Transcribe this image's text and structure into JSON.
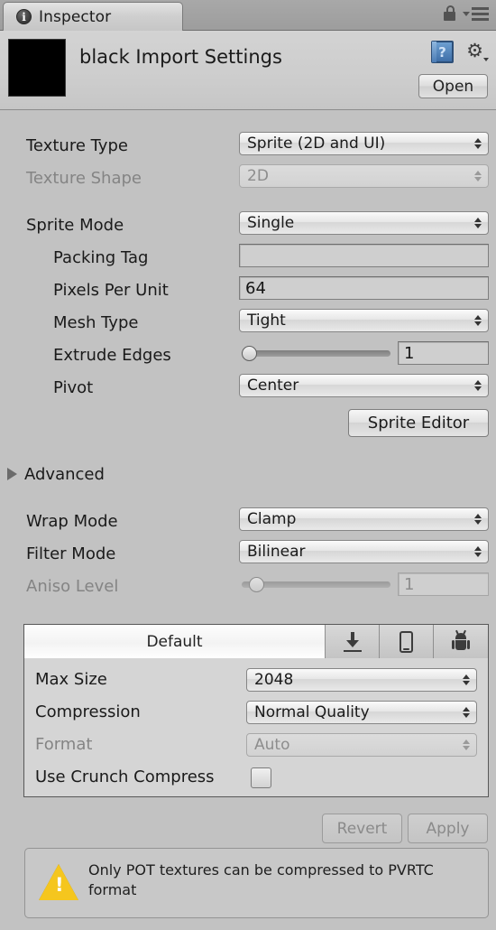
{
  "window": {
    "tab_label": "Inspector",
    "tab_icon": "info-icon",
    "lock_icon": "lock-icon",
    "menu_icon": "hamburger-menu-icon"
  },
  "asset_header": {
    "title": "black Import Settings",
    "preview_color": "#000000",
    "help_icon": "help-book-icon",
    "gear_icon": "gear-icon",
    "open_label": "Open"
  },
  "texture": {
    "texture_type_label": "Texture Type",
    "texture_type_value": "Sprite (2D and UI)",
    "texture_shape_label": "Texture Shape",
    "texture_shape_value": "2D",
    "sprite_mode_label": "Sprite Mode",
    "sprite_mode_value": "Single",
    "packing_tag_label": "Packing Tag",
    "packing_tag_value": "",
    "pixels_per_unit_label": "Pixels Per Unit",
    "pixels_per_unit_value": "64",
    "mesh_type_label": "Mesh Type",
    "mesh_type_value": "Tight",
    "extrude_edges_label": "Extrude Edges",
    "extrude_edges_value": "1",
    "pivot_label": "Pivot",
    "pivot_value": "Center",
    "sprite_editor_label": "Sprite Editor"
  },
  "advanced": {
    "label": "Advanced",
    "expanded": false
  },
  "filtering": {
    "wrap_mode_label": "Wrap Mode",
    "wrap_mode_value": "Clamp",
    "filter_mode_label": "Filter Mode",
    "filter_mode_value": "Bilinear",
    "aniso_level_label": "Aniso Level",
    "aniso_level_value": "1"
  },
  "platform": {
    "tabs": [
      {
        "label": "Default",
        "icon": "",
        "active": true
      },
      {
        "label": "",
        "icon": "standalone-download-icon",
        "active": false
      },
      {
        "label": "",
        "icon": "ios-phone-icon",
        "active": false
      },
      {
        "label": "",
        "icon": "android-robot-icon",
        "active": false
      }
    ],
    "max_size_label": "Max Size",
    "max_size_value": "2048",
    "compression_label": "Compression",
    "compression_value": "Normal Quality",
    "format_label": "Format",
    "format_value": "Auto",
    "crunch_label": "Use Crunch Compress",
    "crunch_checked": false
  },
  "footer": {
    "revert_label": "Revert",
    "apply_label": "Apply",
    "warning_text": "Only POT textures can be compressed to PVRTC format",
    "warning_icon": "warning-triangle-icon"
  }
}
